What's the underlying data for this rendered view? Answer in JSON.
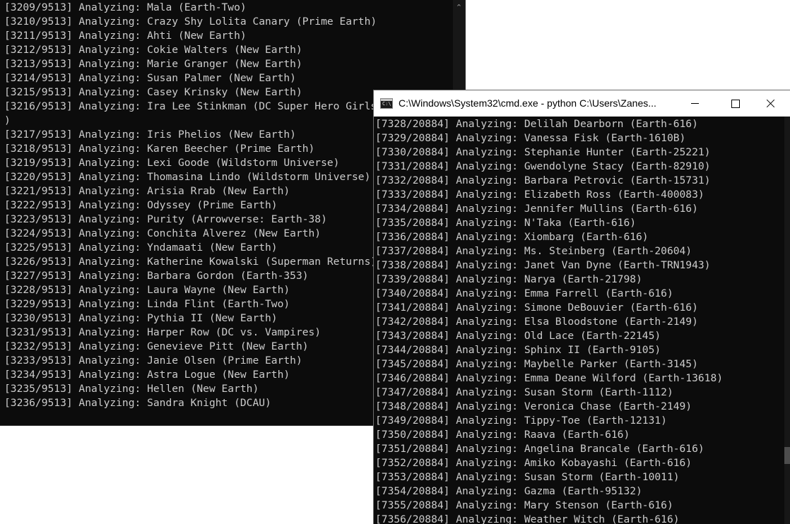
{
  "back_console": {
    "scroll_up_glyph": "⌃",
    "lines": [
      "[3209/9513] Analyzing: Mala (Earth-Two)",
      "[3210/9513] Analyzing: Crazy Shy Lolita Canary (Prime Earth)",
      "[3211/9513] Analyzing: Ahti (New Earth)",
      "[3212/9513] Analyzing: Cokie Walters (New Earth)",
      "[3213/9513] Analyzing: Marie Granger (New Earth)",
      "[3214/9513] Analyzing: Susan Palmer (New Earth)",
      "[3215/9513] Analyzing: Casey Krinsky (New Earth)",
      "[3216/9513] Analyzing: Ira Lee Stinkman (DC Super Hero Girls",
      ")",
      "[3217/9513] Analyzing: Iris Phelios (New Earth)",
      "[3218/9513] Analyzing: Karen Beecher (Prime Earth)",
      "[3219/9513] Analyzing: Lexi Goode (Wildstorm Universe)",
      "[3220/9513] Analyzing: Thomasina Lindo (Wildstorm Universe)",
      "[3221/9513] Analyzing: Arisia Rrab (New Earth)",
      "[3222/9513] Analyzing: Odyssey (Prime Earth)",
      "[3223/9513] Analyzing: Purity (Arrowverse: Earth-38)",
      "[3224/9513] Analyzing: Conchita Alverez (New Earth)",
      "[3225/9513] Analyzing: Yndamaati (New Earth)",
      "[3226/9513] Analyzing: Katherine Kowalski (Superman Returns)",
      "[3227/9513] Analyzing: Barbara Gordon (Earth-353)",
      "[3228/9513] Analyzing: Laura Wayne (New Earth)",
      "[3229/9513] Analyzing: Linda Flint (Earth-Two)",
      "[3230/9513] Analyzing: Pythia II (New Earth)",
      "[3231/9513] Analyzing: Harper Row (DC vs. Vampires)",
      "[3232/9513] Analyzing: Genevieve Pitt (New Earth)",
      "[3233/9513] Analyzing: Janie Olsen (Prime Earth)",
      "[3234/9513] Analyzing: Astra Logue (New Earth)",
      "[3235/9513] Analyzing: Hellen (New Earth)",
      "[3236/9513] Analyzing: Sandra Knight (DCAU)"
    ]
  },
  "front_console": {
    "title": "C:\\Windows\\System32\\cmd.exe - python  C:\\Users\\Zanes...",
    "icon_text": "C:\\",
    "lines": [
      "[7328/20884] Analyzing: Delilah Dearborn (Earth-616)",
      "[7329/20884] Analyzing: Vanessa Fisk (Earth-1610B)",
      "[7330/20884] Analyzing: Stephanie Hunter (Earth-25221)",
      "[7331/20884] Analyzing: Gwendolyne Stacy (Earth-82910)",
      "[7332/20884] Analyzing: Barbara Petrovic (Earth-15731)",
      "[7333/20884] Analyzing: Elizabeth Ross (Earth-400083)",
      "[7334/20884] Analyzing: Jennifer Mullins (Earth-616)",
      "[7335/20884] Analyzing: N'Taka (Earth-616)",
      "[7336/20884] Analyzing: Xiombarg (Earth-616)",
      "[7337/20884] Analyzing: Ms. Steinberg (Earth-20604)",
      "[7338/20884] Analyzing: Janet Van Dyne (Earth-TRN1943)",
      "[7339/20884] Analyzing: Narya (Earth-21798)",
      "[7340/20884] Analyzing: Emma Farrell (Earth-616)",
      "[7341/20884] Analyzing: Simone DeBouvier (Earth-616)",
      "[7342/20884] Analyzing: Elsa Bloodstone (Earth-2149)",
      "[7343/20884] Analyzing: Old Lace (Earth-22145)",
      "[7344/20884] Analyzing: Sphinx II (Earth-9105)",
      "[7345/20884] Analyzing: Maybelle Parker (Earth-3145)",
      "[7346/20884] Analyzing: Emma Deane Wilford (Earth-13618)",
      "[7347/20884] Analyzing: Susan Storm (Earth-1112)",
      "[7348/20884] Analyzing: Veronica Chase (Earth-2149)",
      "[7349/20884] Analyzing: Tippy-Toe (Earth-12131)",
      "[7350/20884] Analyzing: Raava (Earth-616)",
      "[7351/20884] Analyzing: Angelina Brancale (Earth-616)",
      "[7352/20884] Analyzing: Amiko Kobayashi (Earth-616)",
      "[7353/20884] Analyzing: Susan Storm (Earth-10011)",
      "[7354/20884] Analyzing: Gazma (Earth-95132)",
      "[7355/20884] Analyzing: Mary Stenson (Earth-616)",
      "[7356/20884] Analyzing: Weather Witch (Earth-616)"
    ]
  },
  "colors": {
    "console_bg": "#0c0c0c",
    "console_text": "#cccccc",
    "titlebar_bg": "#ffffff"
  }
}
